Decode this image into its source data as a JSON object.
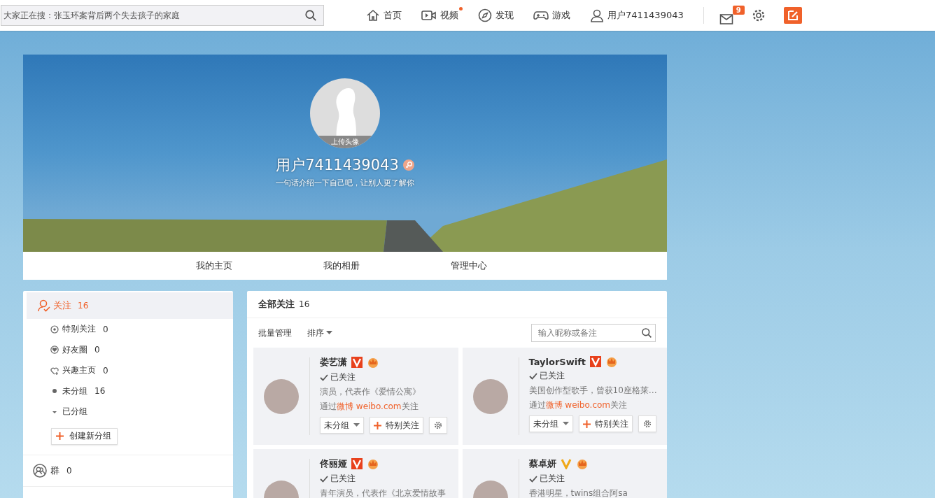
{
  "topbar": {
    "search": {
      "placeholder": "大家正在搜：张玉环案背后两个失去孩子的家庭"
    },
    "nav": [
      {
        "kind": "home",
        "label": "首页",
        "dot": false
      },
      {
        "kind": "video",
        "label": "视频",
        "dot": true
      },
      {
        "kind": "discover",
        "label": "发现",
        "dot": false
      },
      {
        "kind": "game",
        "label": "游戏",
        "dot": false
      },
      {
        "kind": "user",
        "label": "用户7411439043",
        "dot": false
      }
    ],
    "mail_badge": "9"
  },
  "profile": {
    "avatar_caption": "上传头像",
    "name": "用户7411439043",
    "bio": "一句话介绍一下自己吧，让别人更了解你"
  },
  "profile_tabs": [
    {
      "label": "我的主页",
      "selected": false
    },
    {
      "label": "我的相册",
      "selected": false
    },
    {
      "label": "管理中心",
      "selected": false
    }
  ],
  "sidebar": {
    "items": [
      {
        "label": "关注",
        "count": "16",
        "selected": true,
        "children": [
          {
            "kind": "special",
            "label": "特别关注",
            "count": "0"
          },
          {
            "kind": "friends",
            "label": "好友圈",
            "count": "0"
          },
          {
            "kind": "interest",
            "label": "兴趣主页",
            "count": "0"
          },
          {
            "kind": "ungrouped",
            "label": "未分组",
            "count": "16"
          },
          {
            "kind": "grouped",
            "label": "已分组"
          }
        ]
      }
    ],
    "create_group": "创建新分组",
    "groups": {
      "label": "群",
      "count": "0"
    }
  },
  "follows": {
    "title": "全部关注",
    "count": "16",
    "batch": "批量管理",
    "sort": "排序",
    "search": {
      "placeholder": "输入昵称或备注"
    },
    "cards": [
      {
        "name": "娄艺潇",
        "kind": "red-v",
        "status": "已关注",
        "bio": "演员，代表作《爱情公寓》",
        "via_prefix": "通过",
        "via_link": "微博 weibo.com",
        "via_suffix": "关注",
        "group": "未分组",
        "special": "特别关注"
      },
      {
        "name": "TaylorSwift",
        "kind": "red-v",
        "status": "已关注",
        "bio": "美国创作型歌手，曾获10座格莱…",
        "via_prefix": "通过",
        "via_link": "微博 weibo.com",
        "via_suffix": "关注",
        "group": "未分组",
        "special": "特别关注"
      },
      {
        "name": "佟丽娅",
        "kind": "red-v",
        "status": "已关注",
        "bio": "青年演员，代表作《北京爱情故事"
      },
      {
        "name": "蔡卓妍",
        "kind": "gold-v",
        "status": "已关注",
        "bio": "香港明星，twins组合阿sa"
      }
    ]
  }
}
